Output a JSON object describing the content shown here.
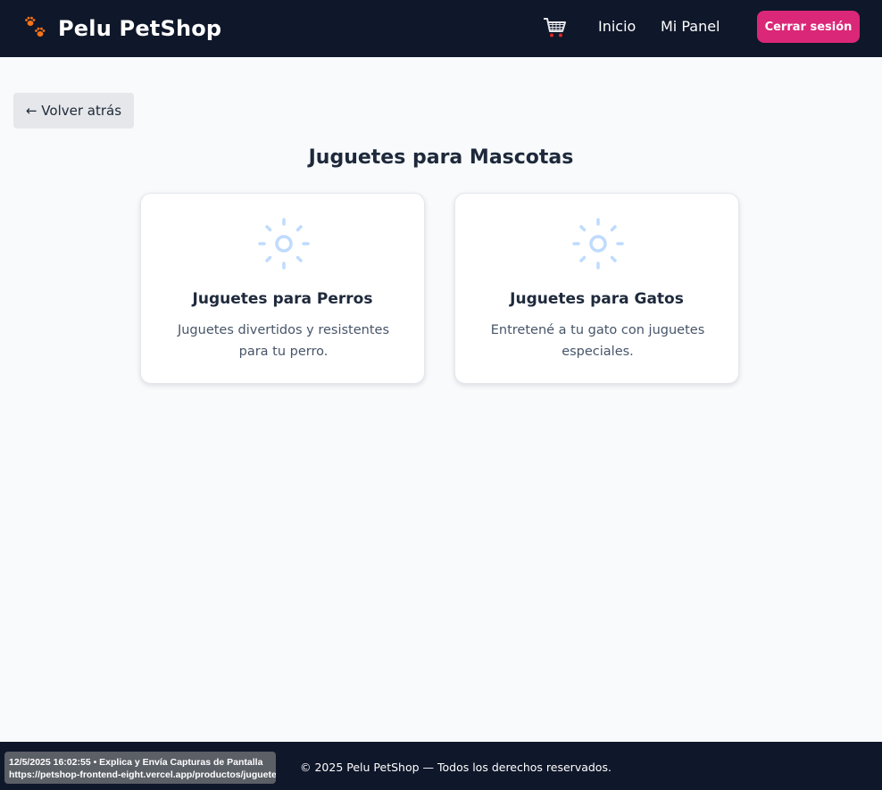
{
  "header": {
    "brand": "Pelu PetShop",
    "nav": [
      "Inicio",
      "Mi Panel"
    ],
    "logout_label": "Cerrar sesión"
  },
  "back_button": "← Volver atrás",
  "page_title": "Juguetes para Mascotas",
  "cards": [
    {
      "title": "Juguetes para Perros",
      "description": "Juguetes divertidos y resistentes para tu perro.",
      "icon": "sun-icon"
    },
    {
      "title": "Juguetes para Gatos",
      "description": "Entretené a tu gato con juguetes especiales.",
      "icon": "sun-icon"
    }
  ],
  "footer": "© 2025 Pelu PetShop — Todos los derechos reservados.",
  "overlay": {
    "line1": "12/5/2025 16:02:55 • Explica y Envía Capturas de Pantalla",
    "line2": "https://petshop-frontend-eight.vercel.app/productos/juguetes"
  },
  "colors": {
    "navbar": "#0f172a",
    "accent": "#db2777",
    "page_bg": "#f8fafc",
    "icon": "#bfdbfe"
  }
}
